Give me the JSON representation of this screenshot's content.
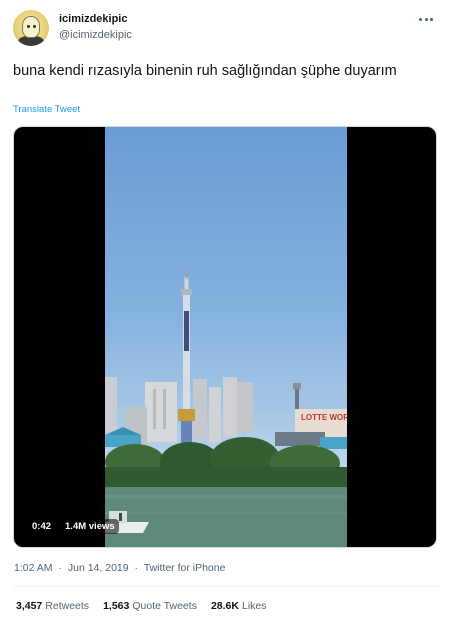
{
  "author": {
    "display_name": "icimizdekipic",
    "handle": "@icimizdekipic"
  },
  "tweet": {
    "text": "buna kendi rızasıyla binenin ruh sağlığından şüphe duyarım",
    "translate_label": "Translate Tweet"
  },
  "video": {
    "duration": "0:42",
    "views": "1.4M views",
    "sign_text": "LOTTE WORLD"
  },
  "meta": {
    "time": "1:02 AM",
    "date": "Jun 14, 2019",
    "separator": "·",
    "source": "Twitter for iPhone"
  },
  "stats": {
    "retweets_count": "3,457",
    "retweets_label": "Retweets",
    "quotes_count": "1,563",
    "quotes_label": "Quote Tweets",
    "likes_count": "28.6K",
    "likes_label": "Likes"
  },
  "colors": {
    "accent": "#1d9bf0",
    "secondary_text": "#536471"
  },
  "icons": {
    "more": "more-horizontal-icon"
  }
}
